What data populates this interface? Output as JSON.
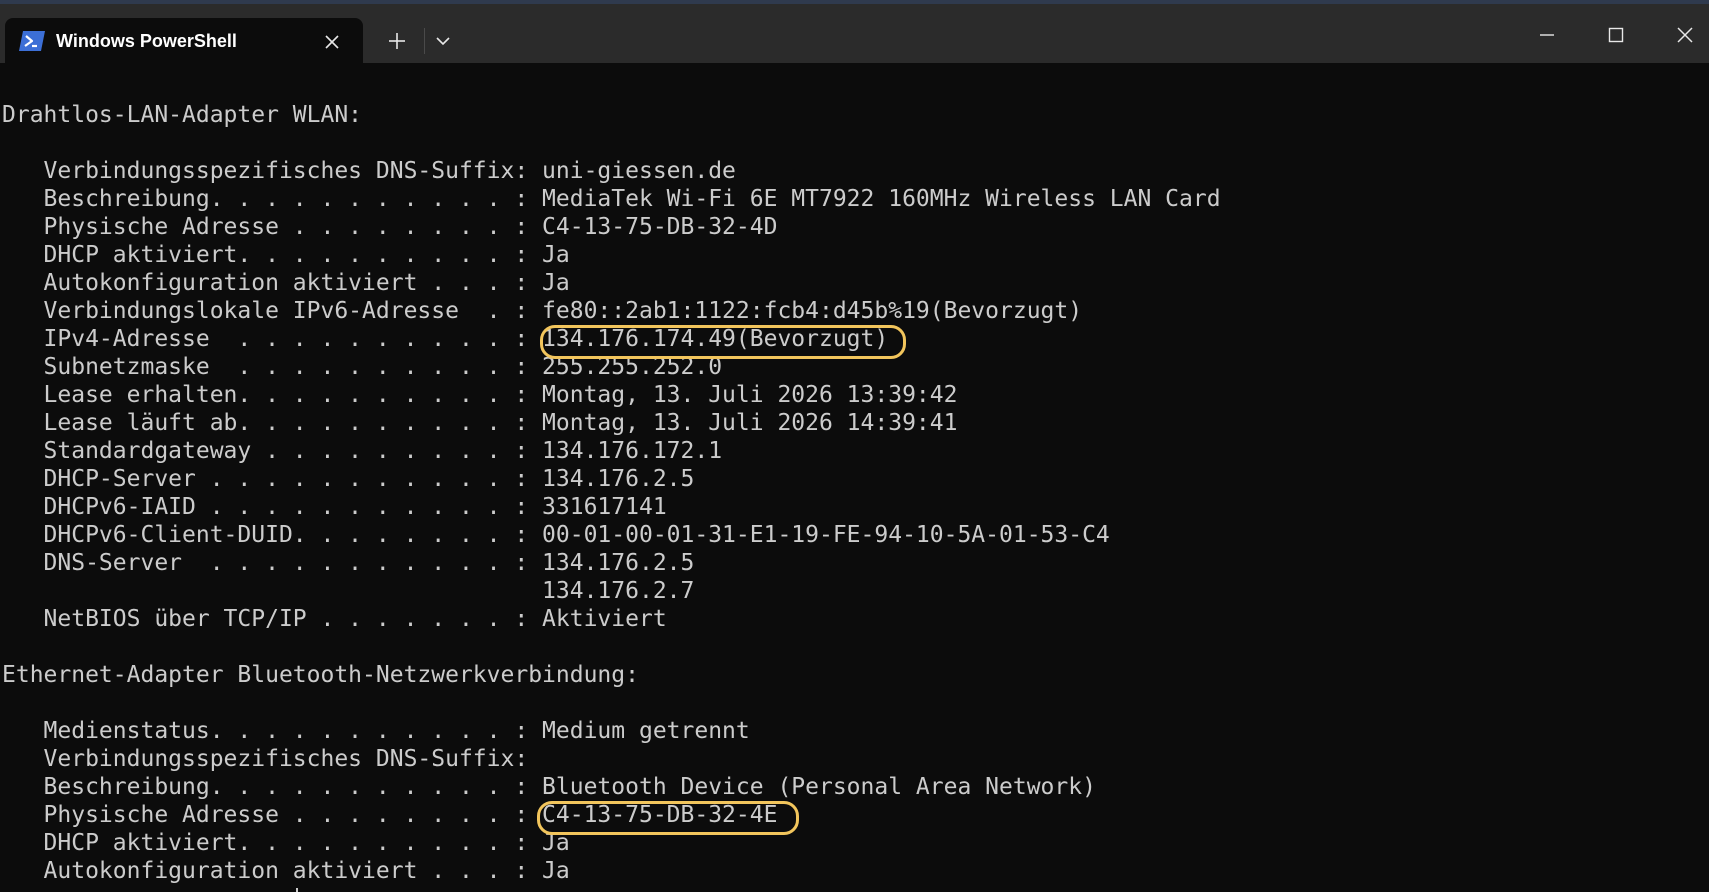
{
  "window": {
    "tab_title": "Windows PowerShell",
    "icons": {
      "tab_icon": "powershell-icon",
      "tab_close": "close-icon",
      "new_tab": "plus-icon",
      "dropdown": "chevron-down-icon",
      "minimize": "minimize-icon",
      "maximize": "maximize-icon",
      "close": "close-icon"
    },
    "colors": {
      "titlebar": "#2b2b2b",
      "terminal_background": "#0c0c0c",
      "terminal_text": "#cccccc",
      "highlight": "#f2c55c",
      "powershell_icon": "#3c6fd6"
    }
  },
  "terminal": {
    "lines": [
      "Drahtlos-LAN-Adapter WLAN:",
      "",
      "   Verbindungsspezifisches DNS-Suffix: uni-giessen.de",
      "   Beschreibung. . . . . . . . . . . : MediaTek Wi-Fi 6E MT7922 160MHz Wireless LAN Card",
      "   Physische Adresse . . . . . . . . : C4-13-75-DB-32-4D",
      "   DHCP aktiviert. . . . . . . . . . : Ja",
      "   Autokonfiguration aktiviert . . . : Ja",
      "   Verbindungslokale IPv6-Adresse  . : fe80::2ab1:1122:fcb4:d45b%19(Bevorzugt)",
      "   IPv4-Adresse  . . . . . . . . . . : 134.176.174.49(Bevorzugt)",
      "   Subnetzmaske  . . . . . . . . . . : 255.255.252.0",
      "   Lease erhalten. . . . . . . . . . : Montag, 13. Juli 2026 13:39:42",
      "   Lease läuft ab. . . . . . . . . . : Montag, 13. Juli 2026 14:39:41",
      "   Standardgateway . . . . . . . . . : 134.176.172.1",
      "   DHCP-Server . . . . . . . . . . . : 134.176.2.5",
      "   DHCPv6-IAID . . . . . . . . . . . : 331617141",
      "   DHCPv6-Client-DUID. . . . . . . . : 00-01-00-01-31-E1-19-FE-94-10-5A-01-53-C4",
      "   DNS-Server  . . . . . . . . . . . : 134.176.2.5",
      "                                       134.176.2.7",
      "   NetBIOS über TCP/IP . . . . . . . : Aktiviert",
      "",
      "Ethernet-Adapter Bluetooth-Netzwerkverbindung:",
      "",
      "   Medienstatus. . . . . . . . . . . : Medium getrennt",
      "   Verbindungsspezifisches DNS-Suffix:",
      "   Beschreibung. . . . . . . . . . . : Bluetooth Device (Personal Area Network)",
      "   Physische Adresse . . . . . . . . : C4-13-75-DB-32-4E",
      "   DHCP aktiviert. . . . . . . . . . : Ja",
      "   Autokonfiguration aktiviert . . . : Ja"
    ],
    "highlighted_values": [
      "134.176.174.49(Bevorzugt)",
      "C4-13-75-DB-32-4E"
    ]
  }
}
